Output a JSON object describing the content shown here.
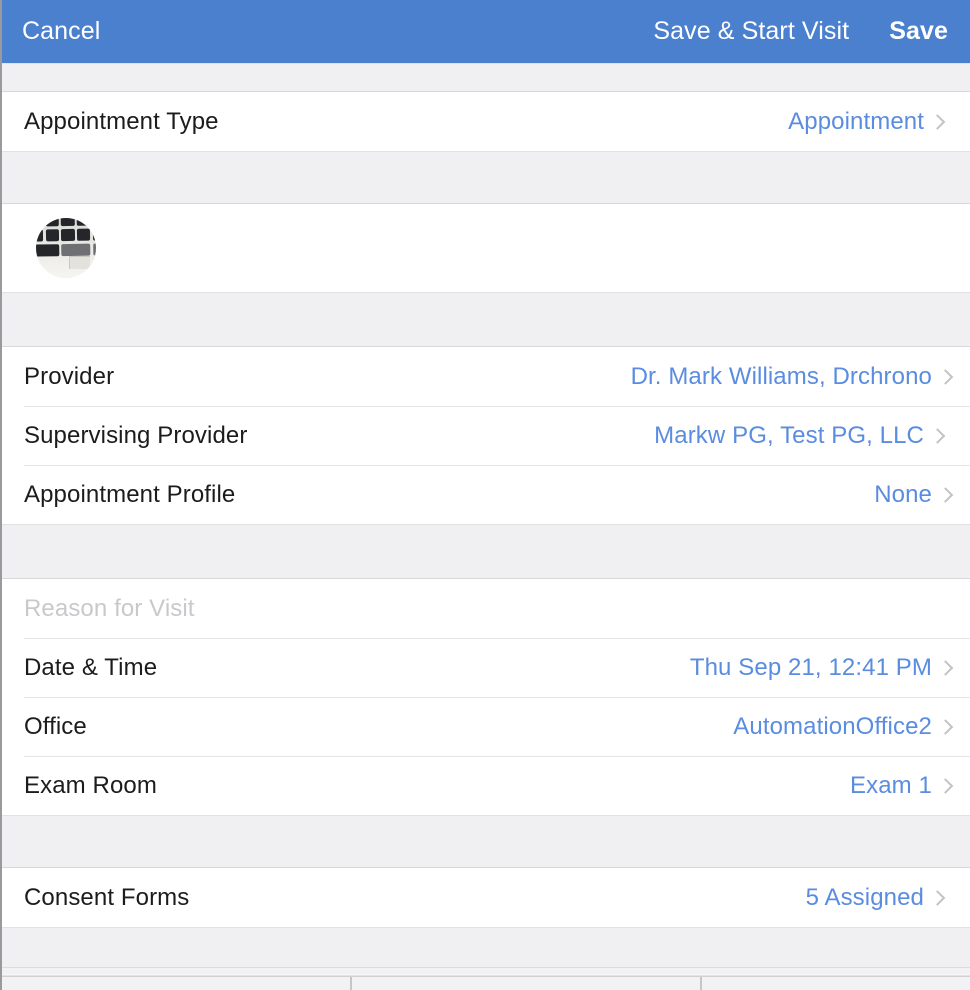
{
  "navbar": {
    "cancel_label": "Cancel",
    "save_start_visit_label": "Save & Start Visit",
    "save_label": "Save",
    "background_color": "#4a80ce",
    "text_color": "#ffffff"
  },
  "theme": {
    "value_blue": "#5a8ce0",
    "label_color": "#1c1c1e",
    "placeholder_color": "#c9c9cd",
    "group_background": "#f0f0f2",
    "row_background": "#ffffff",
    "chevron_color": "#c3c3c7"
  },
  "sections": {
    "appointment_type": {
      "rows": [
        {
          "label": "Appointment Type",
          "value": "Appointment",
          "chevron": "chevron-right-icon"
        }
      ]
    },
    "patient": {
      "avatar": {
        "icon": "patient-avatar",
        "alt": "Patient photo"
      }
    },
    "providers": {
      "rows": [
        {
          "label": "Provider",
          "value": "Dr. Mark Williams, Drchrono",
          "chevron": "chevron-right-icon"
        },
        {
          "label": "Supervising Provider",
          "value": "Markw PG, Test PG, LLC",
          "chevron": "chevron-right-icon"
        },
        {
          "label": "Appointment Profile",
          "value": "None",
          "chevron": "chevron-right-icon"
        }
      ]
    },
    "visit_details": {
      "reason_placeholder": "Reason for Visit",
      "reason_value": "",
      "rows": [
        {
          "label": "Date & Time",
          "value": "Thu Sep 21, 12:41 PM",
          "chevron": "chevron-right-icon"
        },
        {
          "label": "Office",
          "value": "AutomationOffice2",
          "chevron": "chevron-right-icon"
        },
        {
          "label": "Exam Room",
          "value": "Exam 1",
          "chevron": "chevron-right-icon"
        }
      ]
    },
    "consent": {
      "rows": [
        {
          "label": "Consent Forms",
          "value": "5 Assigned",
          "chevron": "chevron-right-icon"
        }
      ]
    }
  }
}
